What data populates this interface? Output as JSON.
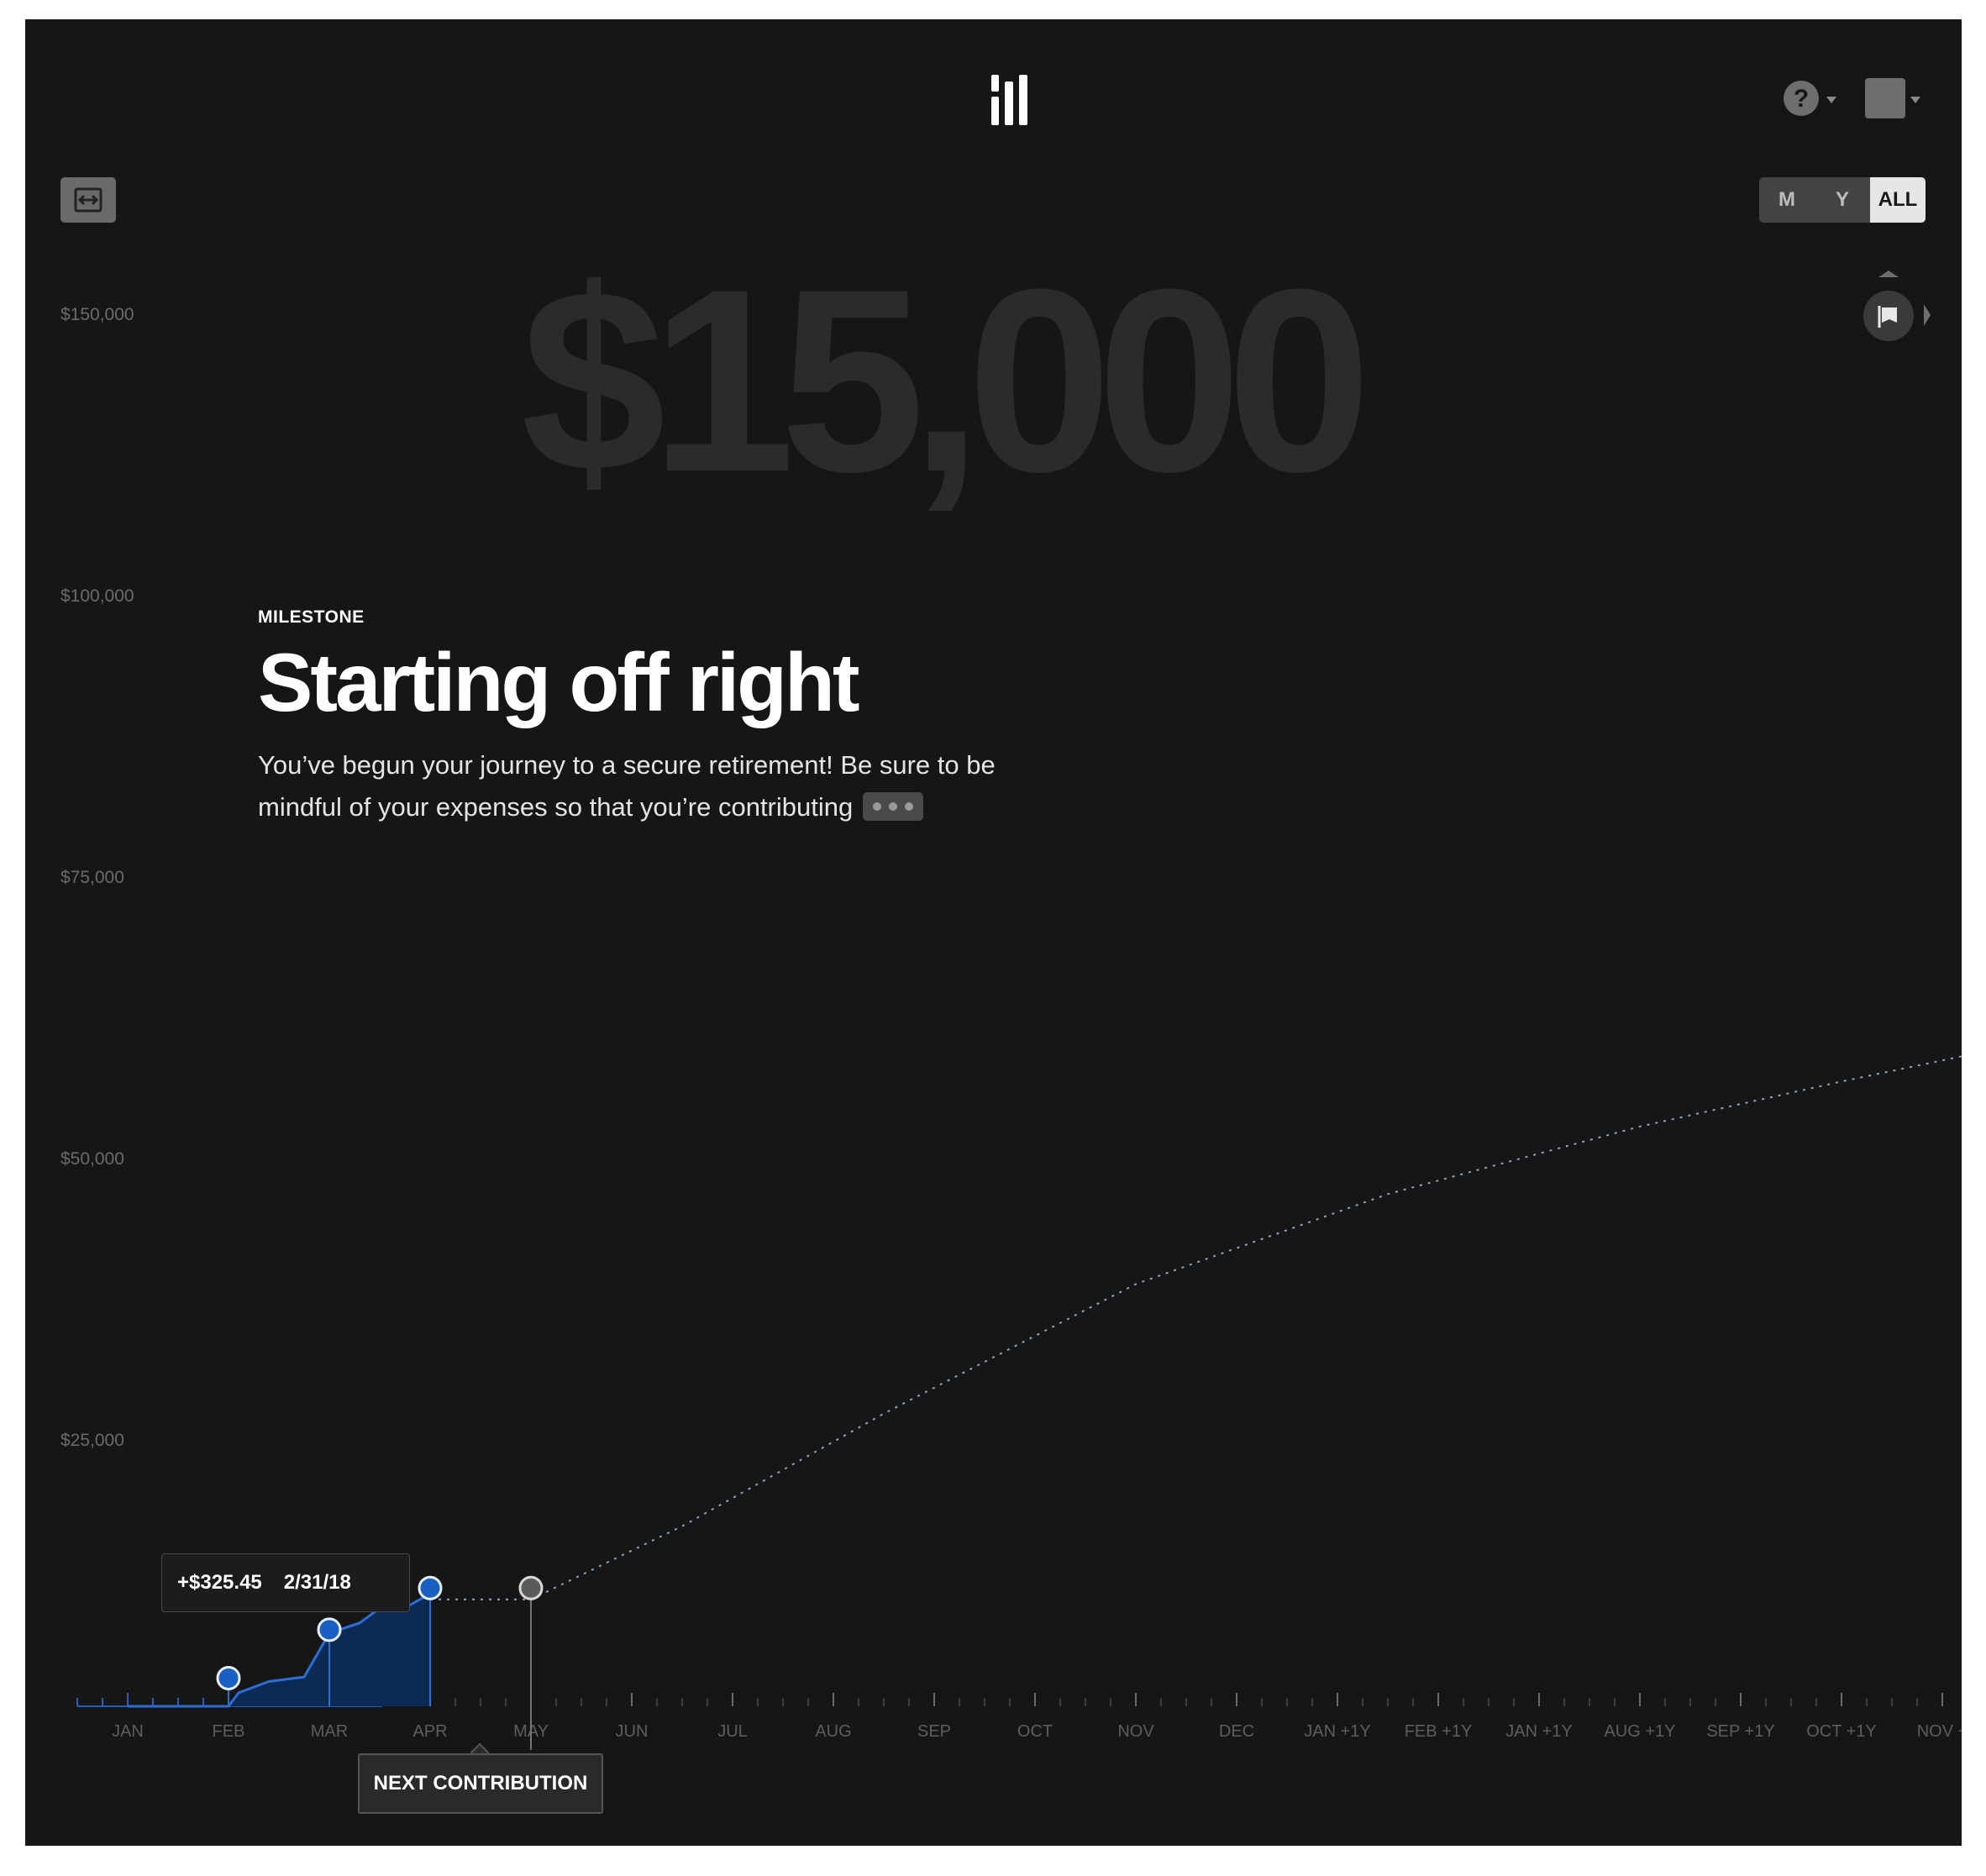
{
  "header": {
    "logo_icon": "brand-logo-icon",
    "help_icon": "help-question-icon",
    "avatar_icon": "user-avatar-icon"
  },
  "controls": {
    "expand_icon": "expand-horizontal-icon",
    "range_options": [
      "M",
      "Y",
      "ALL"
    ],
    "range_selected": "ALL",
    "milestone_flag_icon": "flag-icon"
  },
  "hero": {
    "value": "$15,000"
  },
  "milestone": {
    "label": "MILESTONE",
    "title": "Starting off right",
    "body": "You’ve begun your journey to a secure retirement! Be sure to be mindful of your expenses so that you’re contributing"
  },
  "tooltip": {
    "amount": "+$325.45",
    "date": "2/31/18"
  },
  "next_contribution": {
    "label": "NEXT CONTRIBUTION"
  },
  "colors": {
    "background": "#161616",
    "accent_blue": "#1a5fc4",
    "area_fill": "#0d2a55",
    "projection_line": "#8da6c4"
  },
  "chart_data": {
    "type": "area",
    "y_ticks": [
      "$150,000",
      "$100,000",
      "$75,000",
      "$50,000",
      "$25,000"
    ],
    "x_labels": [
      "JAN",
      "FEB",
      "MAR",
      "APR",
      "MAY",
      "JUN",
      "JUL",
      "AUG",
      "SEP",
      "OCT",
      "NOV",
      "DEC",
      "JAN +1Y",
      "FEB +1Y",
      "JAN +1Y",
      "AUG +1Y",
      "SEP +1Y",
      "OCT +1Y",
      "NOV +"
    ],
    "actual": [
      {
        "x": 0.0,
        "y": 0
      },
      {
        "x": 1.0,
        "y": 0
      },
      {
        "x": 1.1,
        "y": 1200
      },
      {
        "x": 1.4,
        "y": 2200
      },
      {
        "x": 1.75,
        "y": 2600
      },
      {
        "x": 2.0,
        "y": 6500
      },
      {
        "x": 2.3,
        "y": 7400
      },
      {
        "x": 2.5,
        "y": 8700
      },
      {
        "x": 2.8,
        "y": 9000
      },
      {
        "x": 3.0,
        "y": 10000
      }
    ],
    "markers": [
      {
        "x": 1.0,
        "y": 2500
      },
      {
        "x": 2.0,
        "y": 6800
      },
      {
        "x": 3.0,
        "y": 10500
      }
    ],
    "next_contribution_point": {
      "x": 4.0,
      "y": 10500
    },
    "projection": [
      {
        "x": 3.0,
        "y": 9500
      },
      {
        "x": 4.0,
        "y": 9500
      },
      {
        "x": 5.5,
        "y": 16000
      },
      {
        "x": 7.5,
        "y": 26000
      },
      {
        "x": 10.0,
        "y": 37500
      },
      {
        "x": 12.5,
        "y": 45500
      },
      {
        "x": 15.0,
        "y": 51500
      },
      {
        "x": 17.0,
        "y": 55500
      },
      {
        "x": 18.6,
        "y": 58500
      }
    ],
    "grid": false
  }
}
